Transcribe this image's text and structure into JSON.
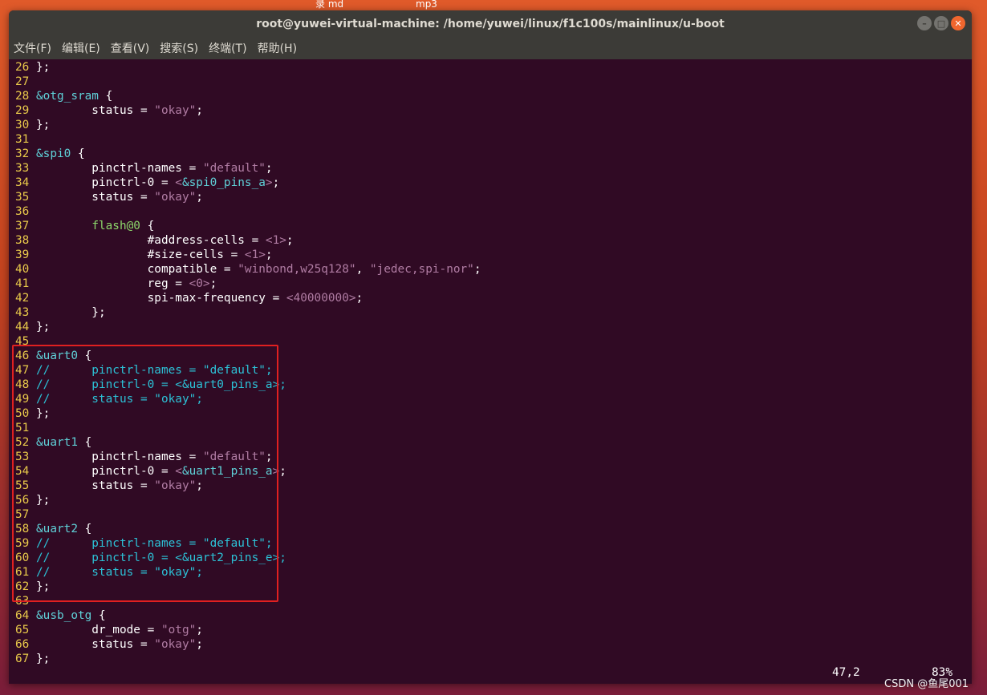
{
  "desktop": {
    "icon1_label": "录 md",
    "icon2_label": "mp3"
  },
  "window": {
    "title": "root@yuwei-virtual-machine: /home/yuwei/linux/f1c100s/mainlinux/u-boot",
    "buttons": {
      "minimize": "–",
      "maximize": "□",
      "close": "✕"
    }
  },
  "menu": [
    "文件(F)",
    "编辑(E)",
    "查看(V)",
    "搜索(S)",
    "终端(T)",
    "帮助(H)"
  ],
  "code_lines": [
    [
      [
        "26 ",
        "ln"
      ],
      [
        "};",
        ""
      ]
    ],
    [
      [
        "27 ",
        "ln"
      ]
    ],
    [
      [
        "28 ",
        "ln"
      ],
      [
        "&otg_sram",
        "t"
      ],
      [
        " {",
        ""
      ]
    ],
    [
      [
        "29 ",
        "ln"
      ],
      [
        "        status = ",
        ""
      ],
      [
        "\"okay\"",
        "s"
      ],
      [
        ";",
        ""
      ]
    ],
    [
      [
        "30 ",
        "ln"
      ],
      [
        "};",
        ""
      ]
    ],
    [
      [
        "31 ",
        "ln"
      ]
    ],
    [
      [
        "32 ",
        "ln"
      ],
      [
        "&spi0",
        "t"
      ],
      [
        " {",
        ""
      ]
    ],
    [
      [
        "33 ",
        "ln"
      ],
      [
        "        pinctrl-names = ",
        ""
      ],
      [
        "\"default\"",
        "s"
      ],
      [
        ";",
        ""
      ]
    ],
    [
      [
        "34 ",
        "ln"
      ],
      [
        "        pinctrl-0 = ",
        ""
      ],
      [
        "<",
        "s"
      ],
      [
        "&spi0_pins_a",
        "t"
      ],
      [
        ">",
        "s"
      ],
      [
        ";",
        ""
      ]
    ],
    [
      [
        "35 ",
        "ln"
      ],
      [
        "        status = ",
        ""
      ],
      [
        "\"okay\"",
        "s"
      ],
      [
        ";",
        ""
      ]
    ],
    [
      [
        "36 ",
        "ln"
      ]
    ],
    [
      [
        "37 ",
        "ln"
      ],
      [
        "        ",
        ""
      ],
      [
        "flash@0",
        "g"
      ],
      [
        " {",
        ""
      ]
    ],
    [
      [
        "38 ",
        "ln"
      ],
      [
        "                #address-cells = ",
        ""
      ],
      [
        "<1>",
        "s"
      ],
      [
        ";",
        ""
      ]
    ],
    [
      [
        "39 ",
        "ln"
      ],
      [
        "                #size-cells = ",
        ""
      ],
      [
        "<1>",
        "s"
      ],
      [
        ";",
        ""
      ]
    ],
    [
      [
        "40 ",
        "ln"
      ],
      [
        "                compatible = ",
        ""
      ],
      [
        "\"winbond,w25q128\"",
        "s"
      ],
      [
        ", ",
        ""
      ],
      [
        "\"jedec,spi-nor\"",
        "s"
      ],
      [
        ";",
        ""
      ]
    ],
    [
      [
        "41 ",
        "ln"
      ],
      [
        "                reg = ",
        ""
      ],
      [
        "<0>",
        "s"
      ],
      [
        ";",
        ""
      ]
    ],
    [
      [
        "42 ",
        "ln"
      ],
      [
        "                spi-max-frequency = ",
        ""
      ],
      [
        "<40000000>",
        "s"
      ],
      [
        ";",
        ""
      ]
    ],
    [
      [
        "43 ",
        "ln"
      ],
      [
        "        };",
        ""
      ]
    ],
    [
      [
        "44 ",
        "ln"
      ],
      [
        "};",
        ""
      ]
    ],
    [
      [
        "45 ",
        "ln"
      ]
    ],
    [
      [
        "46 ",
        "ln"
      ],
      [
        "&uart0",
        "t"
      ],
      [
        " {",
        ""
      ]
    ],
    [
      [
        "47 ",
        "ln"
      ],
      [
        "//      pinctrl-names = \"default\";",
        "c"
      ]
    ],
    [
      [
        "48 ",
        "ln"
      ],
      [
        "//      pinctrl-0 = <&uart0_pins_a>;",
        "c"
      ]
    ],
    [
      [
        "49 ",
        "ln"
      ],
      [
        "//      status = \"okay\";",
        "c"
      ]
    ],
    [
      [
        "50 ",
        "ln"
      ],
      [
        "};",
        ""
      ]
    ],
    [
      [
        "51 ",
        "ln"
      ]
    ],
    [
      [
        "52 ",
        "ln"
      ],
      [
        "&uart1",
        "t"
      ],
      [
        " {",
        ""
      ]
    ],
    [
      [
        "53 ",
        "ln"
      ],
      [
        "        pinctrl-names = ",
        ""
      ],
      [
        "\"default\"",
        "s"
      ],
      [
        ";",
        ""
      ]
    ],
    [
      [
        "54 ",
        "ln"
      ],
      [
        "        pinctrl-0 = ",
        ""
      ],
      [
        "<",
        "s"
      ],
      [
        "&uart1_pins_a",
        "t"
      ],
      [
        ">",
        "s"
      ],
      [
        ";",
        ""
      ]
    ],
    [
      [
        "55 ",
        "ln"
      ],
      [
        "        status = ",
        ""
      ],
      [
        "\"okay\"",
        "s"
      ],
      [
        ";",
        ""
      ]
    ],
    [
      [
        "56 ",
        "ln"
      ],
      [
        "};",
        ""
      ]
    ],
    [
      [
        "57 ",
        "ln"
      ]
    ],
    [
      [
        "58 ",
        "ln"
      ],
      [
        "&uart2",
        "t"
      ],
      [
        " {",
        ""
      ]
    ],
    [
      [
        "59 ",
        "ln"
      ],
      [
        "//      pinctrl-names = \"default\";",
        "c"
      ]
    ],
    [
      [
        "60 ",
        "ln"
      ],
      [
        "//      pinctrl-0 = <&uart2_pins_e>;",
        "c"
      ]
    ],
    [
      [
        "61 ",
        "ln"
      ],
      [
        "//      status = \"okay\";",
        "c"
      ]
    ],
    [
      [
        "62 ",
        "ln"
      ],
      [
        "};",
        ""
      ]
    ],
    [
      [
        "63 ",
        "ln"
      ]
    ],
    [
      [
        "64 ",
        "ln"
      ],
      [
        "&usb_otg",
        "t"
      ],
      [
        " {",
        ""
      ]
    ],
    [
      [
        "65 ",
        "ln"
      ],
      [
        "        dr_mode = ",
        ""
      ],
      [
        "\"otg\"",
        "s"
      ],
      [
        ";",
        ""
      ]
    ],
    [
      [
        "66 ",
        "ln"
      ],
      [
        "        status = ",
        ""
      ],
      [
        "\"okay\"",
        "s"
      ],
      [
        ";",
        ""
      ]
    ],
    [
      [
        "67 ",
        "ln"
      ],
      [
        "};",
        ""
      ]
    ]
  ],
  "status": {
    "position": "47,2",
    "percent": "83%"
  },
  "watermark": "CSDN @鱼尾001"
}
